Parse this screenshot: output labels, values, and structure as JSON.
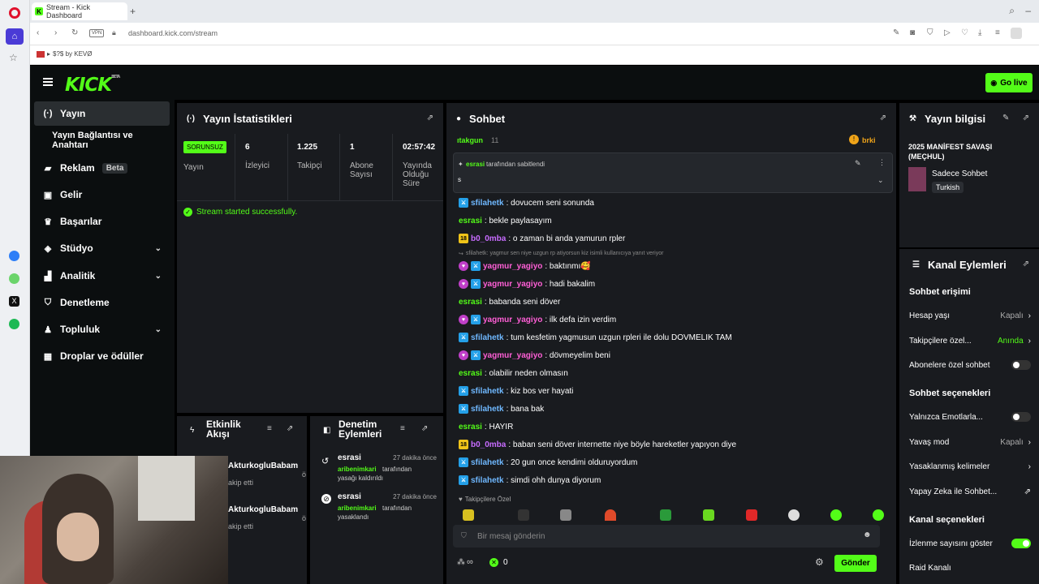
{
  "browser": {
    "tab_title": "Stream - Kick Dashboard",
    "vpn": "VPN",
    "url": "dashboard.kick.com/stream",
    "bookmark": "$?$ by KEVØ"
  },
  "app": {
    "logo": "KICK",
    "logo_badge": "BETA",
    "go_live": "Go live"
  },
  "nav": {
    "items": [
      {
        "label": "Yayın",
        "icon": "broadcast-icon"
      },
      {
        "label": "Yayın Bağlantısı ve Anahtarı",
        "icon": ""
      },
      {
        "label": "Reklam",
        "badge": "Beta",
        "icon": "megaphone-icon"
      },
      {
        "label": "Gelir",
        "icon": "wallet-icon"
      },
      {
        "label": "Başarılar",
        "icon": "trophy-icon"
      },
      {
        "label": "Stüdyo",
        "icon": "layers-icon"
      },
      {
        "label": "Analitik",
        "icon": "chart-icon"
      },
      {
        "label": "Denetleme",
        "icon": "shield-icon"
      },
      {
        "label": "Topluluk",
        "icon": "community-icon"
      },
      {
        "label": "Droplar ve ödüller",
        "icon": "gift-icon"
      }
    ]
  },
  "stats": {
    "title": "Yayın İstatistikleri",
    "status_badge": "SORUNSUZ",
    "status_label": "Yayın",
    "viewers": "6",
    "viewers_label": "İzleyici",
    "followers": "1.225",
    "followers_label": "Takipçi",
    "subs": "1",
    "subs_label": "Abone Sayısı",
    "uptime": "02:57:42",
    "uptime_label": "Yayında Olduğu Süre",
    "success": "Stream started successfully."
  },
  "activity": {
    "title": "Etkinlik Akışı",
    "items": [
      {
        "name": "AkturkogluBabam",
        "suffix": "ö",
        "text": "akip etti"
      },
      {
        "name": "AkturkogluBabam",
        "suffix": "ö",
        "text": "akip etti"
      }
    ]
  },
  "modactions": {
    "title": "Denetim Eylemleri",
    "items": [
      {
        "user": "esrasi",
        "time": "27 dakika önce",
        "actor": "aribenimkari",
        "text": "tarafından",
        "text2": "yasağı kaldırıldı"
      },
      {
        "user": "esrasi",
        "time": "27 dakika önce",
        "actor": "aribenimkari",
        "text": "tarafından",
        "text2": "yasaklandı"
      }
    ]
  },
  "chat": {
    "title": "Sohbet",
    "top_user": "ıtakgun",
    "top_count": "11",
    "top_right": "brki",
    "pinned_by": "esrasi",
    "pinned_text": "tarafından sabitlendi",
    "pinned_msg": "s",
    "reply_hint": "sfilahetk: yagmur sen niye uzgun rp atiyorsun kiz isimli kullanıcıya yanıt veriyor",
    "messages": [
      {
        "user": "sfilahetk",
        "text": ": dovucem seni sonunda",
        "badges": "mod",
        "color": "u-blue"
      },
      {
        "user": "esrasi",
        "text": ": bekle paylasayım",
        "badges": "",
        "color": "u-green"
      },
      {
        "user": "b0_0mba",
        "text": ": o zaman bi anda yamurun rpler",
        "badges": "sub",
        "color": "u-purple"
      },
      {
        "user": "yagmur_yagiyo",
        "text": ": baktınmı🥰",
        "badges": "heart,mod",
        "color": "u-pink"
      },
      {
        "user": "yagmur_yagiyo",
        "text": ": hadi bakalim",
        "badges": "heart,mod",
        "color": "u-pink"
      },
      {
        "user": "esrasi",
        "text": ": babanda seni döver",
        "badges": "",
        "color": "u-green"
      },
      {
        "user": "yagmur_yagiyo",
        "text": ": ilk defa izin verdim",
        "badges": "heart,mod",
        "color": "u-pink"
      },
      {
        "user": "sfilahetk",
        "text": ": tum kesfetim yagmusun uzgun rpleri ile dolu DOVMELIK TAM",
        "badges": "mod",
        "color": "u-blue"
      },
      {
        "user": "yagmur_yagiyo",
        "text": ": dövmeyelim beni",
        "badges": "heart,mod",
        "color": "u-pink"
      },
      {
        "user": "esrasi",
        "text": ": olabilir neden olmasın",
        "badges": "",
        "color": "u-green"
      },
      {
        "user": "sfilahetk",
        "text": ": kiz bos ver hayati",
        "badges": "mod",
        "color": "u-blue"
      },
      {
        "user": "sfilahetk",
        "text": ": bana bak",
        "badges": "mod",
        "color": "u-blue"
      },
      {
        "user": "esrasi",
        "text": ": HAYIR",
        "badges": "",
        "color": "u-green"
      },
      {
        "user": "b0_0mba",
        "text": ": baban seni döver internette niye böyle hareketler yapıyon diye",
        "badges": "sub",
        "color": "u-purple"
      },
      {
        "user": "sfilahetk",
        "text": ": 20 gun once kendimi olduruyordum",
        "badges": "mod",
        "color": "u-blue"
      },
      {
        "user": "sfilahetk",
        "text": ": simdi ohh dunya diyorum",
        "badges": "mod",
        "color": "u-blue"
      }
    ],
    "followers_only": "Takipçilere Özel",
    "input_placeholder": "Bir mesaj gönderin",
    "points": "∞",
    "kicks": "0",
    "send": "Gönder"
  },
  "streaminfo": {
    "title": "Yayın bilgisi",
    "stream_title": "2025 MANİFEST SAVAŞI (MEÇHUL)",
    "category": "Sadece Sohbet",
    "language": "Turkish"
  },
  "channel": {
    "title": "Kanal Eylemleri",
    "chat_access": "Sohbet erişimi",
    "account_age": "Hesap yaşı",
    "account_age_val": "Kapalı",
    "followers_only": "Takipçilere özel...",
    "followers_only_val": "Anında",
    "subs_only": "Abonelere özel sohbet",
    "chat_options": "Sohbet seçenekleri",
    "emotes_only": "Yalnızca Emotlarla...",
    "slow_mode": "Yavaş mod",
    "slow_mode_val": "Kapalı",
    "banned_words": "Yasaklanmış kelimeler",
    "ai": "Yapay Zeka ile Sohbet...",
    "channel_options": "Kanal seçenekleri",
    "show_viewers": "İzlenme sayısını göster",
    "raid": "Raid Kanalı"
  },
  "colors": {
    "accent": "#53fc18",
    "panel": "#191b1f",
    "bg": "#000000"
  }
}
